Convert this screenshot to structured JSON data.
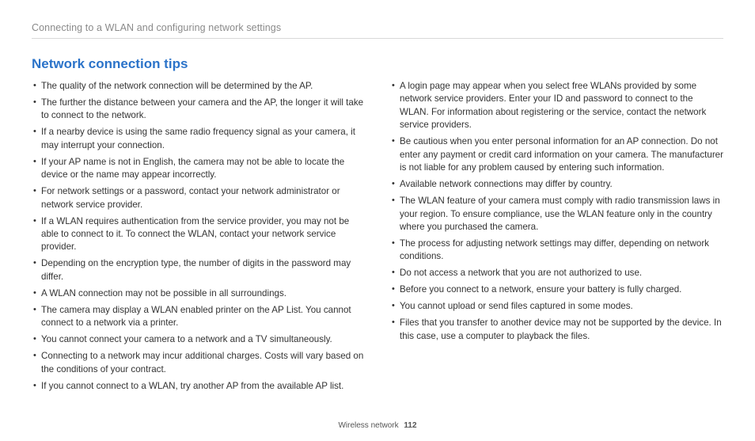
{
  "header": "Connecting to a WLAN and configuring network settings",
  "title": "Network connection tips",
  "left_tips": [
    "The quality of the network connection will be determined by the AP.",
    "The further the distance between your camera and the AP, the longer it will take to connect to the network.",
    "If a nearby device is using the same radio frequency signal as your camera, it may interrupt your connection.",
    "If your AP name is not in English, the camera may not be able to locate the device or the name may appear incorrectly.",
    "For network settings or a password, contact your network administrator or network service provider.",
    "If a WLAN requires authentication from the service provider, you may not be able to connect to it. To connect the WLAN, contact your network service provider.",
    "Depending on the encryption type, the number of digits in the password may differ.",
    "A WLAN connection may not be possible in all surroundings.",
    "The camera may display a WLAN enabled printer on the AP List. You cannot connect to a network via a printer.",
    "You cannot connect your camera to a network and a TV simultaneously.",
    "Connecting to a network may incur additional charges. Costs will vary based on the conditions of your contract.",
    "If you cannot connect to a WLAN, try another AP from the available AP list."
  ],
  "right_tips": [
    "A login page may appear when you select free WLANs provided by some network service providers. Enter your ID and password to connect to the WLAN. For information about registering or the service, contact the network service providers.",
    "Be cautious when you enter personal information for an AP connection. Do not enter any payment or credit card information on your camera. The manufacturer is not liable for any problem caused by entering such information.",
    "Available network connections may differ by country.",
    "The WLAN feature of your camera must comply with radio transmission laws in your region. To ensure compliance, use the WLAN feature only in the country where you purchased the camera.",
    "The process for adjusting network settings may differ, depending on network conditions.",
    "Do not access a network that you are not authorized to use.",
    "Before you connect to a network, ensure your battery is fully charged.",
    "You cannot upload or send files captured in some modes.",
    "Files that you transfer to another device may not be supported by the device. In this case, use a computer to playback the files."
  ],
  "footer_section": "Wireless network",
  "page_number": "112"
}
